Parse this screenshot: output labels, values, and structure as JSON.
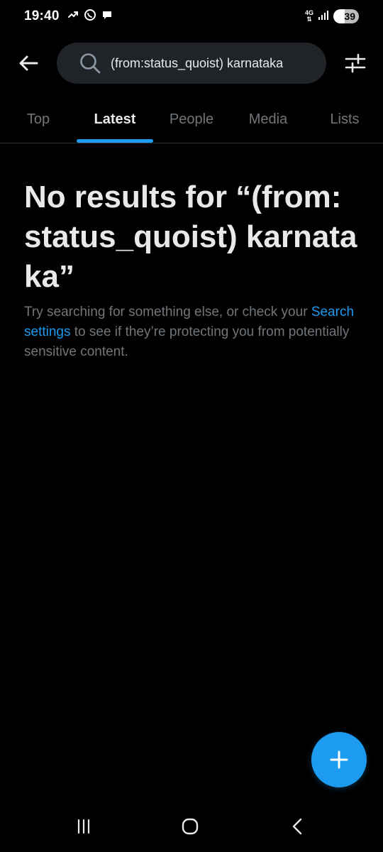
{
  "status_bar": {
    "time": "19:40",
    "network": "4G",
    "battery": "39",
    "icons": [
      "missed-call-icon",
      "whatsapp-icon",
      "chat-bubble-icon",
      "signal-icon"
    ]
  },
  "search": {
    "query": "(from:status_quoist) karnataka",
    "back_icon": "arrow-left-icon",
    "search_icon": "search-icon",
    "filter_icon": "filter-sliders-icon"
  },
  "tabs": [
    {
      "label": "Top",
      "active": false
    },
    {
      "label": "Latest",
      "active": true
    },
    {
      "label": "People",
      "active": false
    },
    {
      "label": "Media",
      "active": false
    },
    {
      "label": "Lists",
      "active": false
    }
  ],
  "empty_state": {
    "title": "No results for “(from:status_quoist) karnataka”",
    "desc_before": "Try searching for something else, or check your ",
    "desc_link": "Search settings",
    "desc_after": " to see if they’re protecting you from potentially sensitive content."
  },
  "fab": {
    "icon": "plus-icon"
  },
  "nav": {
    "recents_icon": "recent-apps-icon",
    "home_icon": "home-circle-icon",
    "back_icon": "back-chevron-icon"
  },
  "colors": {
    "background": "#000000",
    "accent": "#1d9bf0",
    "text_primary": "#e7e9ea",
    "text_secondary": "#71767b",
    "search_bg": "#202327",
    "divider": "#2f3336"
  }
}
